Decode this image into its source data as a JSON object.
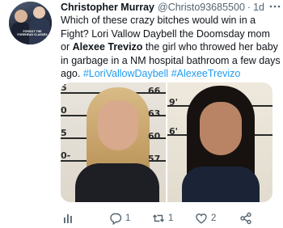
{
  "tweet": {
    "author_name": "Christopher Murray",
    "author_handle": "@Christo93685500",
    "separator": "·",
    "time": "1d",
    "text_part1": "Which of these crazy bitches would win in a Fight? Lori Vallow Daybell the Doomsday mom or ",
    "bold_name": "Alexee Trevizo",
    "text_part2": " the girl who throwed her baby in garbage in a NM hospital bathroom a few days ago. ",
    "hashtag1": "#LoriVallowDaybell",
    "space": " ",
    "hashtag2": "#AlexeeTrevizo"
  },
  "avatar": {
    "caption": "FORGOT THE FOREHEAD CLASSES"
  },
  "media": {
    "left_ruler": [
      "66",
      "63",
      "60",
      "57"
    ],
    "left_ruler_side": [
      "5",
      "0",
      "5",
      "0-"
    ],
    "right_ruler": [
      "9'",
      "6'"
    ]
  },
  "actions": {
    "replies": "1",
    "retweets": "1",
    "likes": "2"
  },
  "colors": {
    "link": "#1d9bf0",
    "muted": "#536471",
    "text": "#0f1419"
  },
  "icons": [
    "more-icon",
    "analytics-icon",
    "reply-icon",
    "retweet-icon",
    "like-icon",
    "share-icon"
  ]
}
